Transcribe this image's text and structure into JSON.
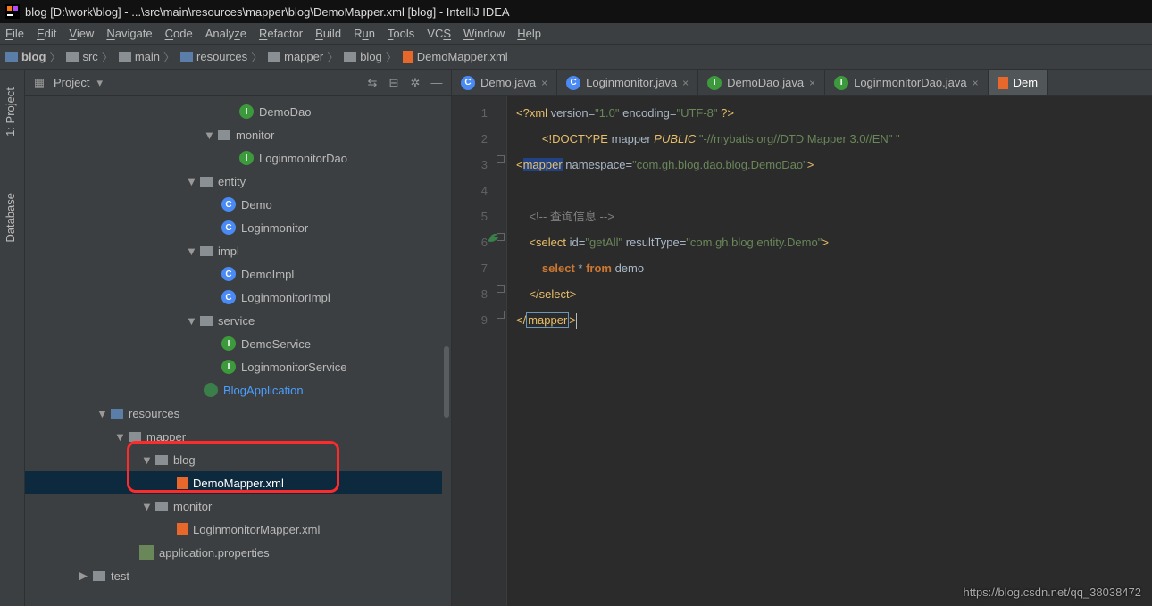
{
  "title": "blog [D:\\work\\blog] - ...\\src\\main\\resources\\mapper\\blog\\DemoMapper.xml [blog] - IntelliJ IDEA",
  "menu": [
    "File",
    "Edit",
    "View",
    "Navigate",
    "Code",
    "Analyze",
    "Refactor",
    "Build",
    "Run",
    "Tools",
    "VCS",
    "Window",
    "Help"
  ],
  "breadcrumbs": [
    "blog",
    "src",
    "main",
    "resources",
    "mapper",
    "blog",
    "DemoMapper.xml"
  ],
  "left_tabs": {
    "project": "1: Project",
    "database": "Database"
  },
  "sidebar": {
    "header": "Project"
  },
  "tree": {
    "n0": "DemoDao",
    "n1": "monitor",
    "n2": "LoginmonitorDao",
    "n3": "entity",
    "n4": "Demo",
    "n5": "Loginmonitor",
    "n6": "impl",
    "n7": "DemoImpl",
    "n8": "LoginmonitorImpl",
    "n9": "service",
    "n10": "DemoService",
    "n11": "LoginmonitorService",
    "n12": "BlogApplication",
    "n13": "resources",
    "n14": "mapper",
    "n15": "blog",
    "n16": "DemoMapper.xml",
    "n17": "monitor",
    "n18": "LoginmonitorMapper.xml",
    "n19": "application.properties",
    "n20": "test"
  },
  "tabs": [
    {
      "label": "Demo.java",
      "icon": "c"
    },
    {
      "label": "Loginmonitor.java",
      "icon": "c"
    },
    {
      "label": "DemoDao.java",
      "icon": "i"
    },
    {
      "label": "LoginmonitorDao.java",
      "icon": "i"
    },
    {
      "label": "Dem",
      "icon": "xml",
      "active": true
    }
  ],
  "code": {
    "l1a": "<?xml ",
    "l1b": "version",
    "l1c": "=",
    "l1d": "\"1.0\"",
    "l1e": " encoding",
    "l1f": "=",
    "l1g": "\"UTF-8\"",
    "l1h": " ?>",
    "l2a": "<!DOCTYPE ",
    "l2b": "mapper ",
    "l2c": "PUBLIC ",
    "l2d": "\"-//mybatis.org//DTD Mapper 3.0//EN\" \"",
    "l3a": "<",
    "l3b": "mapper",
    "l3c": " namespace",
    "l3d": "=",
    "l3e": "\"com.gh.blog.dao.blog.DemoDao\"",
    "l3f": ">",
    "l5a": "<!-- 查询信息 -->",
    "l6a": "<",
    "l6b": "select ",
    "l6c": "id",
    "l6d": "=",
    "l6e": "\"getAll\"",
    "l6f": " resultType",
    "l6g": "=",
    "l6h": "\"com.gh.blog.entity.Demo\"",
    "l6i": ">",
    "l7a": "select ",
    "l7b": "* ",
    "l7c": "from ",
    "l7d": "demo",
    "l8a": "</",
    "l8b": "select",
    "l8c": ">",
    "l9a": "</",
    "l9b": "mapper",
    "l9c": ">"
  },
  "line_numbers": [
    "1",
    "2",
    "3",
    "4",
    "5",
    "6",
    "7",
    "8",
    "9"
  ],
  "watermark": "https://blog.csdn.net/qq_38038472"
}
